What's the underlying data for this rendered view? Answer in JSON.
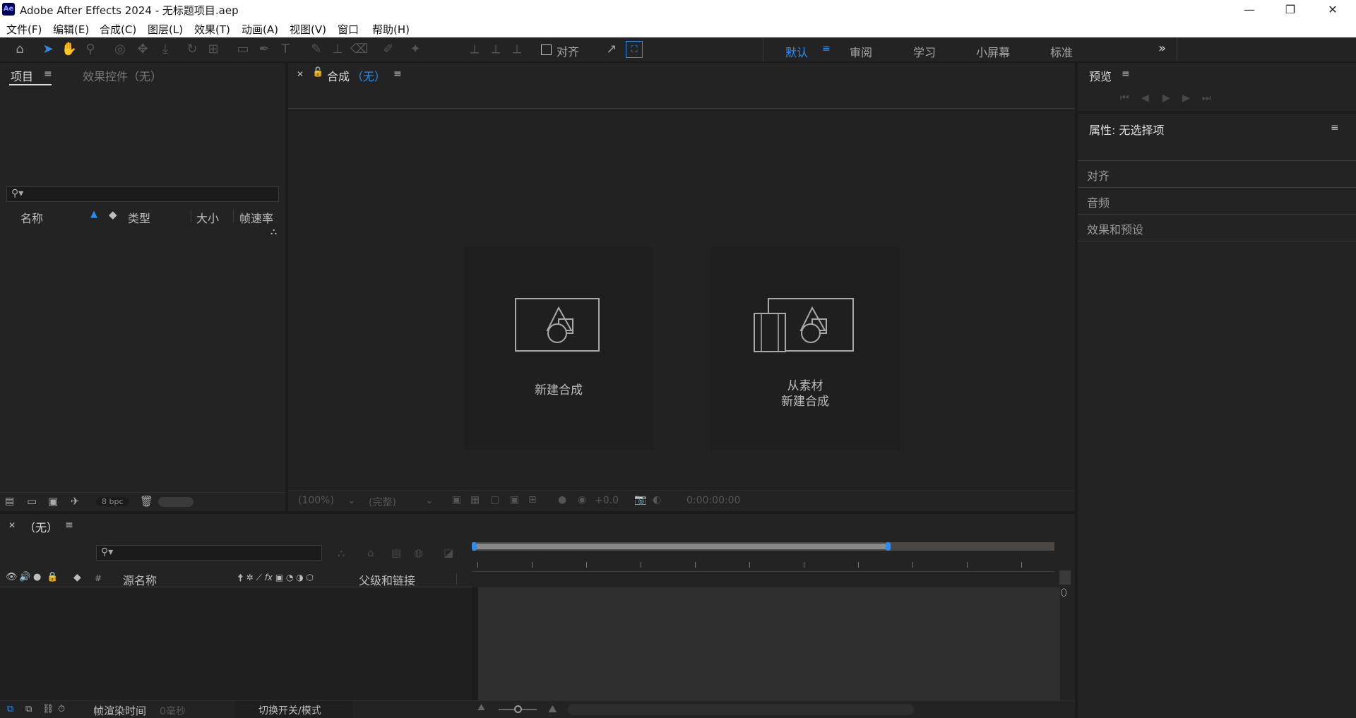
{
  "window": {
    "title": "Adobe After Effects 2024 - 无标题项目.aep",
    "app_icon_text": "Ae",
    "min_glyph": "—",
    "restore_glyph": "❐",
    "close_glyph": "✕"
  },
  "menu": [
    "文件(F)",
    "编辑(E)",
    "合成(C)",
    "图层(L)",
    "效果(T)",
    "动画(A)",
    "视图(V)",
    "窗口",
    "帮助(H)"
  ],
  "toolbar": {
    "align_label": "对齐",
    "workspaces": [
      "默认",
      "审阅",
      "学习",
      "小屏幕",
      "标准"
    ],
    "active_workspace": "默认",
    "more_glyph": "»"
  },
  "project_panel": {
    "tab_project": "项目",
    "tab_effects": "效果控件（无）",
    "search_placeholder": "",
    "columns": [
      "名称",
      "类型",
      "大小",
      "帧速率"
    ],
    "bpc": "8 bpc"
  },
  "comp_panel": {
    "tab_label": "合成",
    "tab_suffix": "（无）",
    "card_new": "新建合成",
    "card_from_footage_line1": "从素材",
    "card_from_footage_line2": "新建合成",
    "zoom": "(100%)",
    "quality": "(完整)",
    "exposure": "+0.0",
    "timecode": "0:00:00:00"
  },
  "preview_panel": {
    "title": "预览"
  },
  "properties_panel": {
    "title": "属性: 无选择项",
    "sections": [
      "对齐",
      "音频",
      "效果和预设"
    ]
  },
  "timeline": {
    "tab_label": "（无）",
    "columns": {
      "source_name": "源名称",
      "parent": "父级和链接",
      "hash": "#"
    },
    "render_time_label": "帧渲染时间",
    "render_time_value": "0毫秒",
    "toggle_label": "切换开关/模式"
  },
  "colors": {
    "accent": "#2d8ceb",
    "panel": "#232323",
    "bg": "#1b1b1b"
  }
}
